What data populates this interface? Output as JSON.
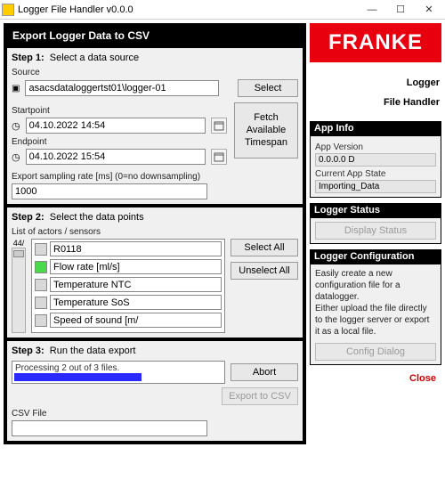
{
  "window": {
    "title": "Logger File Handler v0.0.0"
  },
  "export_banner": "Export Logger Data to CSV",
  "step1": {
    "title": "Step 1:  Select a data source",
    "source_label": "Source",
    "source_value": "asacsdataloggertst01\\logger-01",
    "select_btn": "Select",
    "startpoint_label": "Startpoint",
    "startpoint_value": "04.10.2022 14:54",
    "endpoint_label": "Endpoint",
    "endpoint_value": "04.10.2022 15:54",
    "fetch_btn": "Fetch\nAvailable\nTimespan",
    "rate_label": "Export sampling rate [ms] (0=no downsampling)",
    "rate_value": "1000"
  },
  "step2": {
    "title": "Step 2:  Select the data points",
    "list_label": "List of actors / sensors",
    "slider_label": "44/",
    "items": [
      {
        "label": "R0118",
        "on": false
      },
      {
        "label": "Flow rate [ml/s]",
        "on": true
      },
      {
        "label": "Temperature NTC",
        "on": false
      },
      {
        "label": "Temperature SoS",
        "on": false
      },
      {
        "label": "Speed of sound [m/",
        "on": false
      }
    ],
    "select_all": "Select All",
    "unselect_all": "Unselect All"
  },
  "step3": {
    "title": "Step 3:  Run the data export",
    "progress_text": "Processing 2 out of 3 files.",
    "abort": "Abort",
    "export_btn": "Export to CSV",
    "csv_label": "CSV File",
    "csv_value": ""
  },
  "brand": "FRANKE",
  "app_title_1": "Logger",
  "app_title_2": "File Handler",
  "appinfo": {
    "header": "App Info",
    "ver_label": "App Version",
    "ver_value": "0.0.0.0 D",
    "state_label": "Current App State",
    "state_value": "Importing_Data"
  },
  "logger_status": {
    "header": "Logger Status",
    "btn": "Display Status"
  },
  "logger_cfg": {
    "header": "Logger Configuration",
    "desc": "Easily create a new configuration file for a datalogger.\nEither upload the file directly to the logger server or export it as a local file.",
    "btn": "Config Dialog"
  },
  "close": "Close"
}
